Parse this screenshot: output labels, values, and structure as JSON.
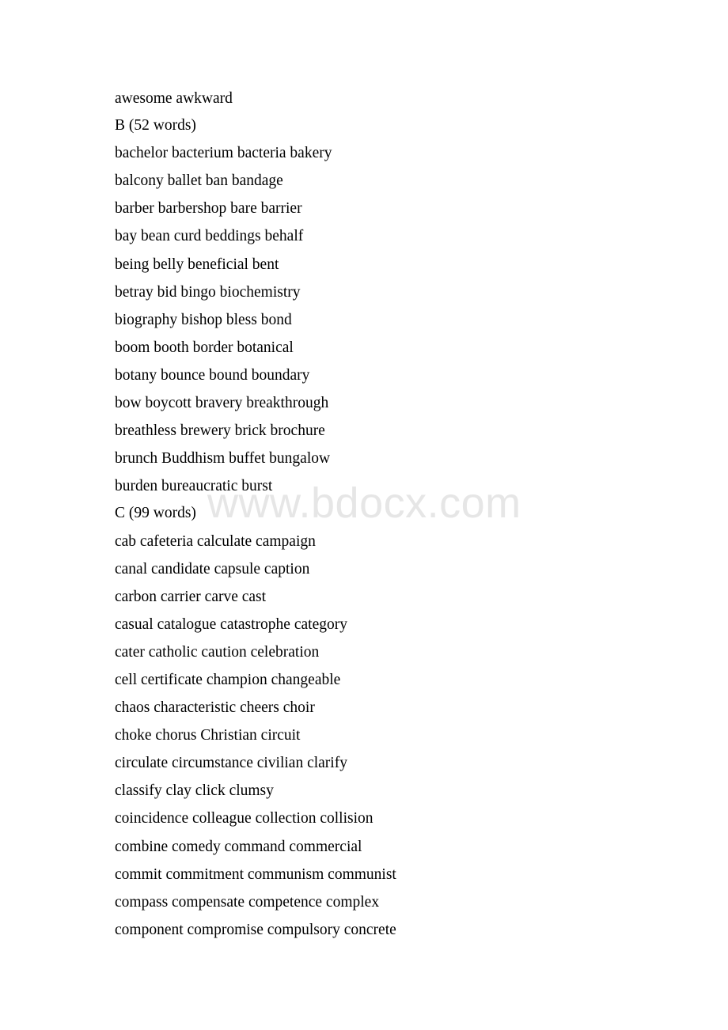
{
  "document": {
    "type": "word-list",
    "watermark": "www.bdocx.com",
    "background_color": "#ffffff",
    "text_color": "#000000",
    "watermark_color": "#e6e6e6"
  },
  "lines": [
    {
      "kind": "words",
      "text": "awesome   awkward"
    },
    {
      "kind": "heading",
      "text": "B (52 words)"
    },
    {
      "kind": "words",
      "text": "bachelor   bacterium   bacteria   bakery"
    },
    {
      "kind": "words",
      "text": "balcony   ballet   ban   bandage"
    },
    {
      "kind": "words",
      "text": "barber   barbershop  bare   barrier"
    },
    {
      "kind": "words",
      "text": "bay   bean curd   beddings   behalf"
    },
    {
      "kind": "words",
      "text": "being   belly   beneficial   bent"
    },
    {
      "kind": "words",
      "text": "betray   bid   bingo   biochemistry"
    },
    {
      "kind": "words",
      "text": "biography  bishop   bless   bond"
    },
    {
      "kind": "words",
      "text": "boom   booth   border   botanical"
    },
    {
      "kind": "words",
      "text": "botany   bounce   bound   boundary"
    },
    {
      "kind": "words",
      "text": "bow   boycott  bravery  breakthrough"
    },
    {
      "kind": "words",
      "text": "breathless   brewery   brick   brochure"
    },
    {
      "kind": "words",
      "text": "brunch   Buddhism  buffet   bungalow"
    },
    {
      "kind": "words",
      "text": "burden   bureaucratic  burst"
    },
    {
      "kind": "heading",
      "text": "C (99 words)"
    },
    {
      "kind": "words",
      "text": "cab   cafeteria   calculate   campaign"
    },
    {
      "kind": "words",
      "text": "canal   candidate   capsule   caption"
    },
    {
      "kind": "words",
      "text": "carbon   carrier   carve   cast"
    },
    {
      "kind": "words",
      "text": "casual   catalogue   catastrophe  category"
    },
    {
      "kind": "words",
      "text": "cater   catholic   caution   celebration"
    },
    {
      "kind": "words",
      "text": "cell   certificate   champion   changeable"
    },
    {
      "kind": "words",
      "text": "chaos   characteristic  cheers   choir"
    },
    {
      "kind": "words",
      "text": "choke   chorus   Christian   circuit"
    },
    {
      "kind": "words",
      "text": "circulate   circumstance  civilian   clarify"
    },
    {
      "kind": "words",
      "text": "classify   clay   click   clumsy"
    },
    {
      "kind": "words",
      "text": "coincidence   colleague   collection   collision"
    },
    {
      "kind": "words",
      "text": "combine   comedy   command   commercial"
    },
    {
      "kind": "words",
      "text": "commit   commitment   communism  communist"
    },
    {
      "kind": "words",
      "text": "compass   compensate   competence   complex"
    },
    {
      "kind": "words",
      "text": "component  compromise  compulsory   concrete"
    }
  ]
}
